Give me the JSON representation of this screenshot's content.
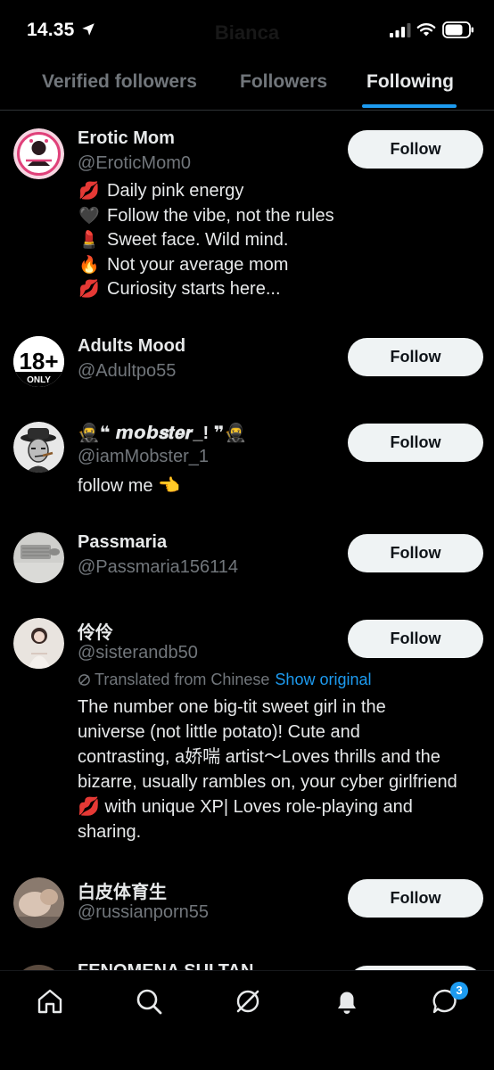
{
  "status_bar": {
    "time": "14.35",
    "title": "Bianca"
  },
  "tabs": [
    {
      "label": "Verified followers",
      "active": false
    },
    {
      "label": "Followers",
      "active": false
    },
    {
      "label": "Following",
      "active": true
    }
  ],
  "follow_label": "Follow",
  "users": [
    {
      "name": "Erotic Mom",
      "handle": "@EroticMom0",
      "bio": [
        {
          "icon": "💋",
          "text": "Daily pink energy"
        },
        {
          "icon": "🖤",
          "text": "Follow the vibe, not the rules"
        },
        {
          "icon": "💄",
          "text": "Sweet face. Wild mind."
        },
        {
          "icon": "🔥",
          "text": "Not your average mom"
        },
        {
          "icon": "💋",
          "text": "Curiosity starts here..."
        }
      ]
    },
    {
      "name": "Adults Mood",
      "handle": "@Adultpo55",
      "avatar_text": "18+",
      "avatar_subtext": "ONLY"
    },
    {
      "name": "🥷❝ 𝙢𝙤𝙗𝒔𝒕𝒆𝒓_! ❞🥷",
      "handle": "@iamMobster_1",
      "bio_text": "follow me 👈"
    },
    {
      "name": "Passmaria",
      "handle": "@Passmaria156114"
    },
    {
      "name": "伶伶",
      "handle": "@sisterandb50",
      "translated_label": "Translated from Chinese",
      "show_original": "Show original",
      "bio_lines": [
        "The number one big-tit sweet girl in the",
        "universe (not little potato)! Cute and",
        "contrasting, a娇喘 artist～Loves thrills and the",
        "bizarre, usually rambles on, your cyber girlfriend",
        "💋  with unique XP| Loves role-playing and",
        "sharing."
      ]
    },
    {
      "name": "白皮体育生",
      "handle": "@russianporn55"
    },
    {
      "name": "FENOMENA SULTAN"
    }
  ],
  "bottom_nav": {
    "items": [
      "home-icon",
      "search-icon",
      "grok-icon",
      "notifications-icon",
      "messages-icon"
    ],
    "messages_badge": "3"
  },
  "colors": {
    "accent": "#1d9bf0",
    "background": "#000000",
    "secondary_text": "#71767b",
    "button_bg": "#eff3f4"
  }
}
